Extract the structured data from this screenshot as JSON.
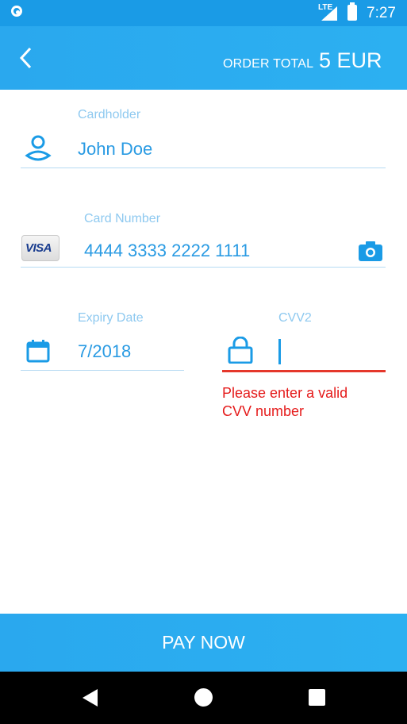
{
  "status_bar": {
    "network": "LTE",
    "time": "7:27"
  },
  "header": {
    "order_total_label": "ORDER TOTAL",
    "order_total_value": "5 EUR"
  },
  "cardholder": {
    "label": "Cardholder",
    "value": "John Doe"
  },
  "card_number": {
    "label": "Card Number",
    "value": "4444 3333 2222 1111",
    "brand": "VISA"
  },
  "expiry": {
    "label": "Expiry Date",
    "value": "7/2018"
  },
  "cvv": {
    "label": "CVV2",
    "value": "",
    "error": "Please enter a valid CVV number"
  },
  "pay_button": {
    "label": "PAY NOW"
  },
  "colors": {
    "accent": "#2aa8ee",
    "status_bar": "#1a9be6",
    "text_blue": "#2a9be3",
    "label_blue": "#8ec9f0",
    "error": "#e51b1b"
  },
  "icons": [
    "back-arrow-icon",
    "user-icon",
    "camera-icon",
    "calendar-icon",
    "lock-icon"
  ]
}
